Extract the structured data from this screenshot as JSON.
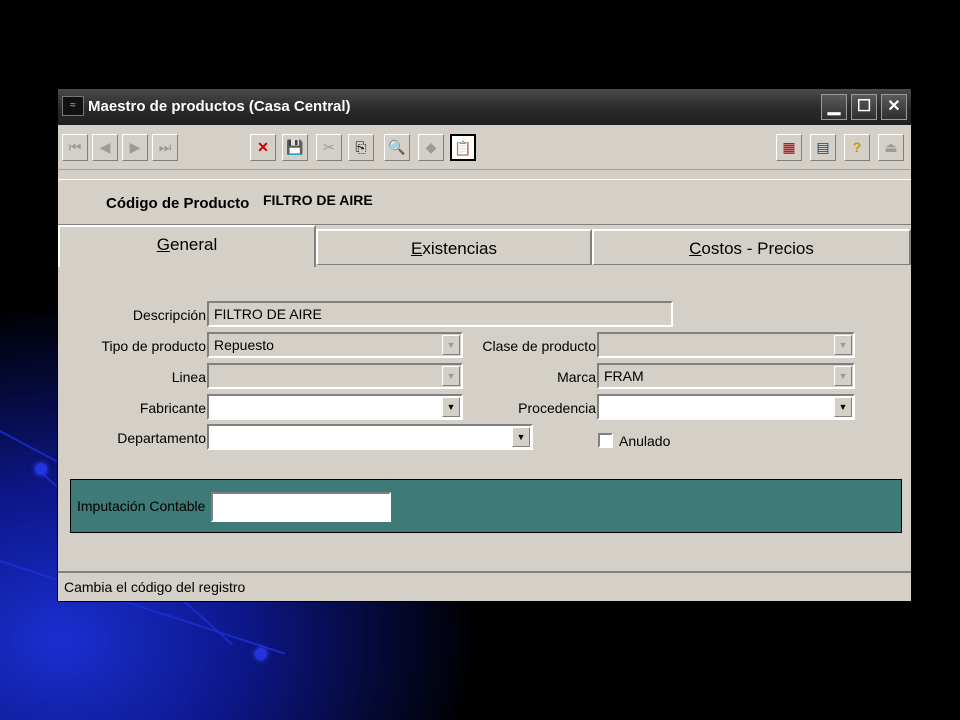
{
  "window": {
    "title": "Maestro de productos (Casa Central)",
    "controls": {
      "minimize": "▁",
      "maximize": "☐",
      "close": "✕"
    }
  },
  "toolbar": {
    "nav": [
      {
        "name": "first-record-icon",
        "glyph": "⏮"
      },
      {
        "name": "prev-record-icon",
        "glyph": "◀"
      },
      {
        "name": "next-record-icon",
        "glyph": "▶"
      },
      {
        "name": "last-record-icon",
        "glyph": "⏭"
      }
    ],
    "actions": [
      {
        "name": "delete-icon",
        "glyph": "✕",
        "color": "#cc0000"
      },
      {
        "name": "save-icon",
        "glyph": "💾"
      },
      {
        "name": "cut-icon",
        "glyph": "✂"
      },
      {
        "name": "copy-icon",
        "glyph": "⎘"
      },
      {
        "name": "find-icon",
        "glyph": "🔍"
      },
      {
        "name": "clear-icon",
        "glyph": "◆"
      },
      {
        "name": "paste-icon",
        "glyph": "📋"
      }
    ],
    "right": [
      {
        "name": "calculator-grid-icon",
        "glyph": "▦"
      },
      {
        "name": "calculator-icon",
        "glyph": "▤"
      },
      {
        "name": "help-icon",
        "glyph": "?"
      },
      {
        "name": "exit-icon",
        "glyph": "⏏"
      }
    ]
  },
  "product": {
    "code_label": "Código de Producto",
    "code_value": "FILTRO DE AIRE"
  },
  "tabs": [
    {
      "label": "General",
      "mnemonic": "G",
      "rest": "eneral",
      "active": true
    },
    {
      "label": "Existencias",
      "mnemonic": "E",
      "rest": "xistencias",
      "active": false
    },
    {
      "label": "Costos - Precios",
      "mnemonic": "C",
      "rest": "ostos - Precios",
      "active": false
    }
  ],
  "form": {
    "descripcion": {
      "label": "Descripción",
      "value": "FILTRO DE AIRE"
    },
    "tipo": {
      "label": "Tipo de producto",
      "value": "Repuesto"
    },
    "clase": {
      "label": "Clase de producto",
      "value": ""
    },
    "linea": {
      "label": "Linea",
      "value": ""
    },
    "marca": {
      "label": "Marca",
      "value": "FRAM"
    },
    "fabricante": {
      "label": "Fabricante",
      "value": ""
    },
    "procedencia": {
      "label": "Procedencia",
      "value": ""
    },
    "departamento": {
      "label": "Departamento",
      "value": ""
    },
    "anulado": {
      "label": "Anulado",
      "checked": false
    },
    "imputacion": {
      "label": "Imputación Contable",
      "value": ""
    },
    "dropdown_glyph": "▼"
  },
  "status": {
    "text": "Cambia el código del registro"
  },
  "colors": {
    "accent_panel": "#3d7a78",
    "background": "#d4d0c8"
  }
}
